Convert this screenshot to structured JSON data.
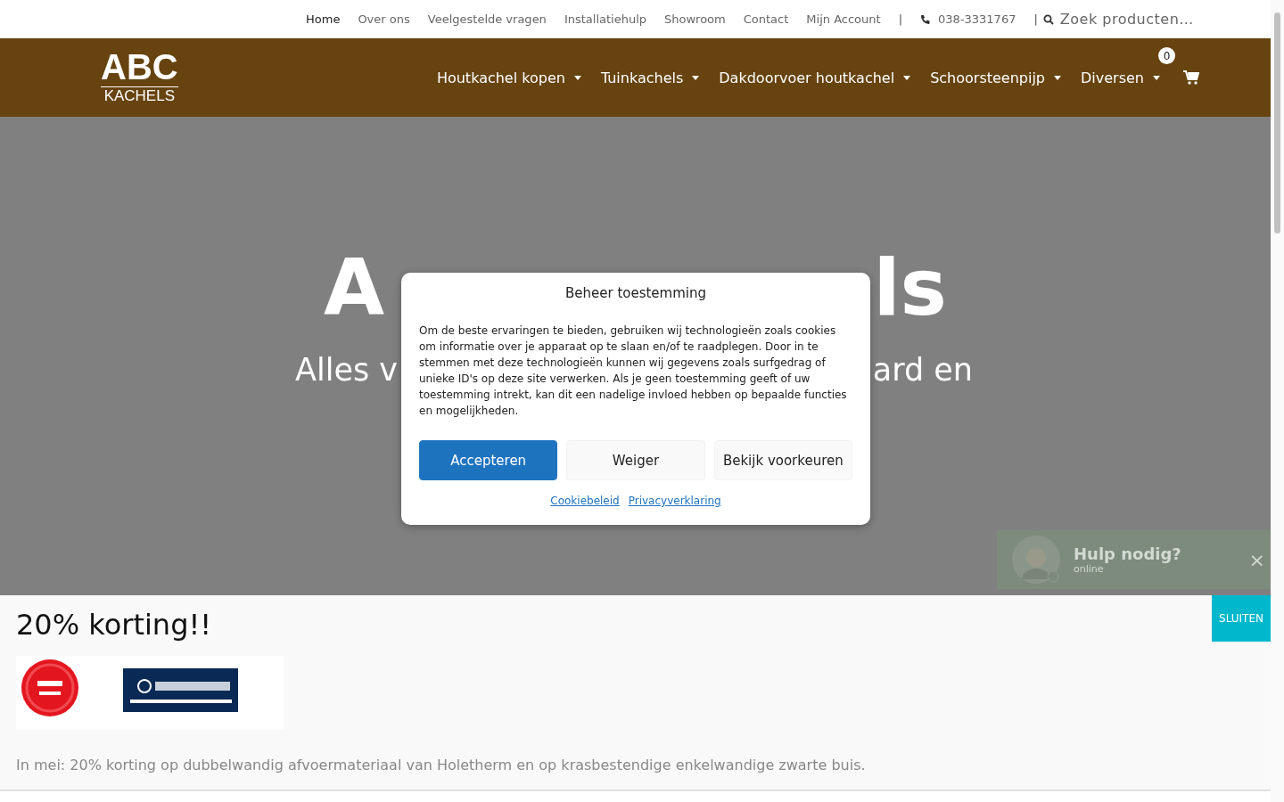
{
  "top_links": [
    {
      "label": "Home",
      "selected": true
    },
    {
      "label": "Over ons",
      "selected": false
    },
    {
      "label": "Veelgestelde vragen",
      "selected": false
    },
    {
      "label": "Installatiehulp",
      "selected": false
    },
    {
      "label": "Showroom",
      "selected": false
    },
    {
      "label": "Contact",
      "selected": false
    },
    {
      "label": "Mijn Account",
      "selected": false
    }
  ],
  "separator": "|",
  "phone": "038-3331767",
  "search": {
    "placeholder": "Zoek producten…"
  },
  "logo": {
    "top": "ABC",
    "bottom": "KACHELS"
  },
  "nav": [
    {
      "label": "Houtkachel kopen"
    },
    {
      "label": "Tuinkachels"
    },
    {
      "label": "Dakdoorvoer houtkachel"
    },
    {
      "label": "Schoorsteenpijp"
    },
    {
      "label": "Diversen"
    }
  ],
  "cart": {
    "count": "0"
  },
  "hero": {
    "title_parts": [
      "A",
      "ls"
    ],
    "subtitle_parts": [
      "Alles v",
      "ard en"
    ]
  },
  "consent": {
    "title": "Beheer toestemming",
    "text": "Om de beste ervaringen te bieden, gebruiken wij technologieën zoals cookies om informatie over je apparaat op te slaan en/of te raadplegen. Door in te stemmen met deze technologieën kunnen wij gegevens zoals surfgedrag of unieke ID's op deze site verwerken. Als je geen toestemming geeft of uw toestemming intrekt, kan dit een nadelige invloed hebben op bepaalde functies en mogelijkheden.",
    "buttons": [
      {
        "label": "Accepteren",
        "kind": "primary"
      },
      {
        "label": "Weiger",
        "kind": "secondary"
      },
      {
        "label": "Bekijk voorkeuren",
        "kind": "secondary"
      }
    ],
    "links": [
      "Cookiebeleid",
      "Privacyverklaring"
    ]
  },
  "chat": {
    "title": "Hulp nodig?",
    "status": "online",
    "close": "×"
  },
  "promo": {
    "title": "20% korting!!",
    "text": "In mei: 20% korting op dubbelwandig afvoermateriaal van Holetherm en op krasbestendige enkelwandige zwarte buis.",
    "close": "SLUITEN"
  }
}
